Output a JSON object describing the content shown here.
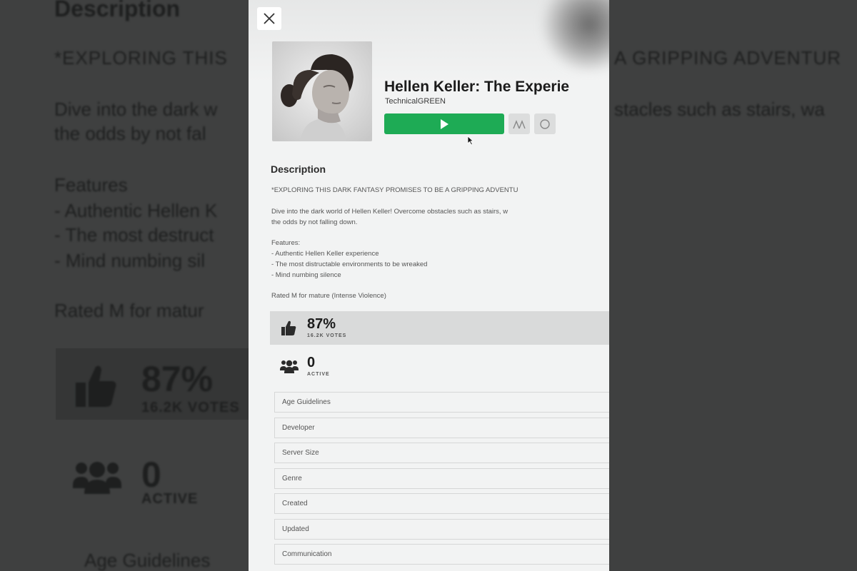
{
  "background": {
    "heading": "Description",
    "line1_left": "*EXPLORING THIS",
    "line1_right": "A GRIPPING ADVENTUR",
    "line2_left": "Dive into the dark w",
    "line2_right": "stacles such as stairs, wa",
    "line3": "the odds by not fal",
    "features": "Features",
    "feat1": "- Authentic Hellen K",
    "feat2": "- The most destruct",
    "feat3": "- Mind numbing sil",
    "rated": "Rated M for matur",
    "percent": "87%",
    "votes": "16.2K VOTES",
    "active_count": "0",
    "active_label": "ACTIVE",
    "age": "Age Guidelines"
  },
  "modal": {
    "title": "Hellen Keller: The Experie",
    "creator": "TechnicalGREEN",
    "description_heading": "Description",
    "desc_line1": "*EXPLORING THIS DARK FANTASY PROMISES TO BE A GRIPPING ADVENTU",
    "desc_para2": "Dive into the dark world of Hellen Keller! Overcome obstacles such as stairs, w\nthe odds by not falling down.",
    "features": "Features:\n- Authentic Hellen Keller experience\n- The most distructable environments to be wreaked\n- Mind numbing silence",
    "rated": "Rated M for mature (Intense Violence)",
    "rating_percent": "87%",
    "rating_votes": "16.2K VOTES",
    "active_count": "0",
    "active_label": "ACTIVE",
    "details": [
      "Age Guidelines",
      "Developer",
      "Server Size",
      "Genre",
      "Created",
      "Updated",
      "Communication"
    ]
  },
  "icons": {
    "close": "close-icon",
    "play": "play-icon",
    "notify": "notification-icon",
    "favorite": "favorite-icon",
    "thumbs": "thumbs-up-icon",
    "people": "people-icon"
  },
  "colors": {
    "play": "#1eab55",
    "modal_bg": "#f2f3f3",
    "overlay": "#3f4040"
  }
}
